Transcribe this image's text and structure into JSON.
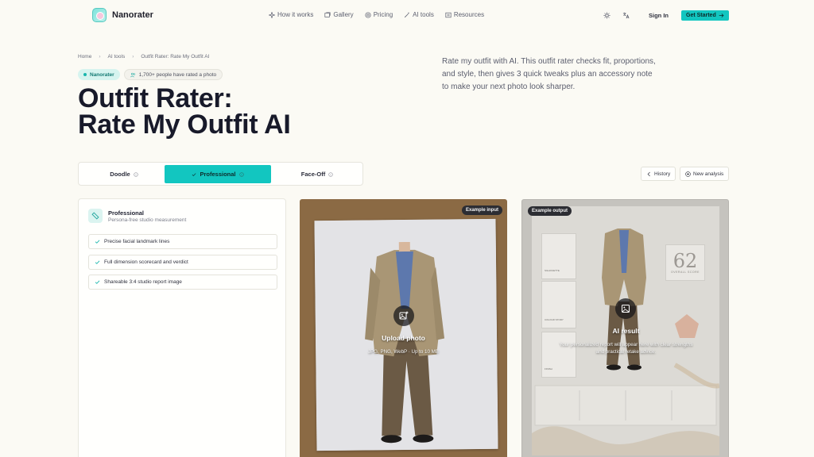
{
  "brand": {
    "name": "Nanorater"
  },
  "nav": {
    "items": [
      {
        "label": "How it works",
        "icon": "sparkle-icon"
      },
      {
        "label": "Gallery",
        "icon": "gallery-icon"
      },
      {
        "label": "Pricing",
        "icon": "coin-icon"
      },
      {
        "label": "AI tools",
        "icon": "wand-icon"
      },
      {
        "label": "Resources",
        "icon": "book-icon"
      }
    ],
    "sign_in": "Sign In",
    "get_started": "Get Started"
  },
  "breadcrumb": [
    "Home",
    "AI tools",
    "Outfit Rater: Rate My Outfit AI"
  ],
  "chips": {
    "brand": "Nanorater",
    "count": "1,700+ people have rated a photo"
  },
  "hero": {
    "title_line1": "Outfit Rater:",
    "title_line2": "Rate My Outfit AI",
    "lede": "Rate my outfit with AI. This outfit rater checks fit, proportions, and style, then gives 3 quick tweaks plus an accessory note to make your next photo look sharper."
  },
  "tabs": [
    {
      "label": "Doodle",
      "active": false
    },
    {
      "label": "Professional",
      "active": true
    },
    {
      "label": "Face-Off",
      "active": false
    }
  ],
  "actions": {
    "history": "History",
    "new_analysis": "New analysis"
  },
  "panel": {
    "title": "Professional",
    "subtitle": "Persona-free studio measurement",
    "features": [
      "Precise facial landmark lines",
      "Full dimension scorecard and verdict",
      "Shareable 3:4 studio report image"
    ]
  },
  "input_card": {
    "badge": "Example input",
    "title": "Upload photo",
    "subtitle": "JPG, PNG, WebP · Up to 10 MB"
  },
  "output_card": {
    "badge": "Example output",
    "title": "AI result",
    "subtitle": "Your personalized report will appear here with clear strengths and practical retake advice.",
    "score": "62",
    "score_label": "OVERALL SCORE"
  },
  "colors": {
    "accent": "#12c6c0",
    "background": "#fbfaf4",
    "text": "#181a2a"
  }
}
